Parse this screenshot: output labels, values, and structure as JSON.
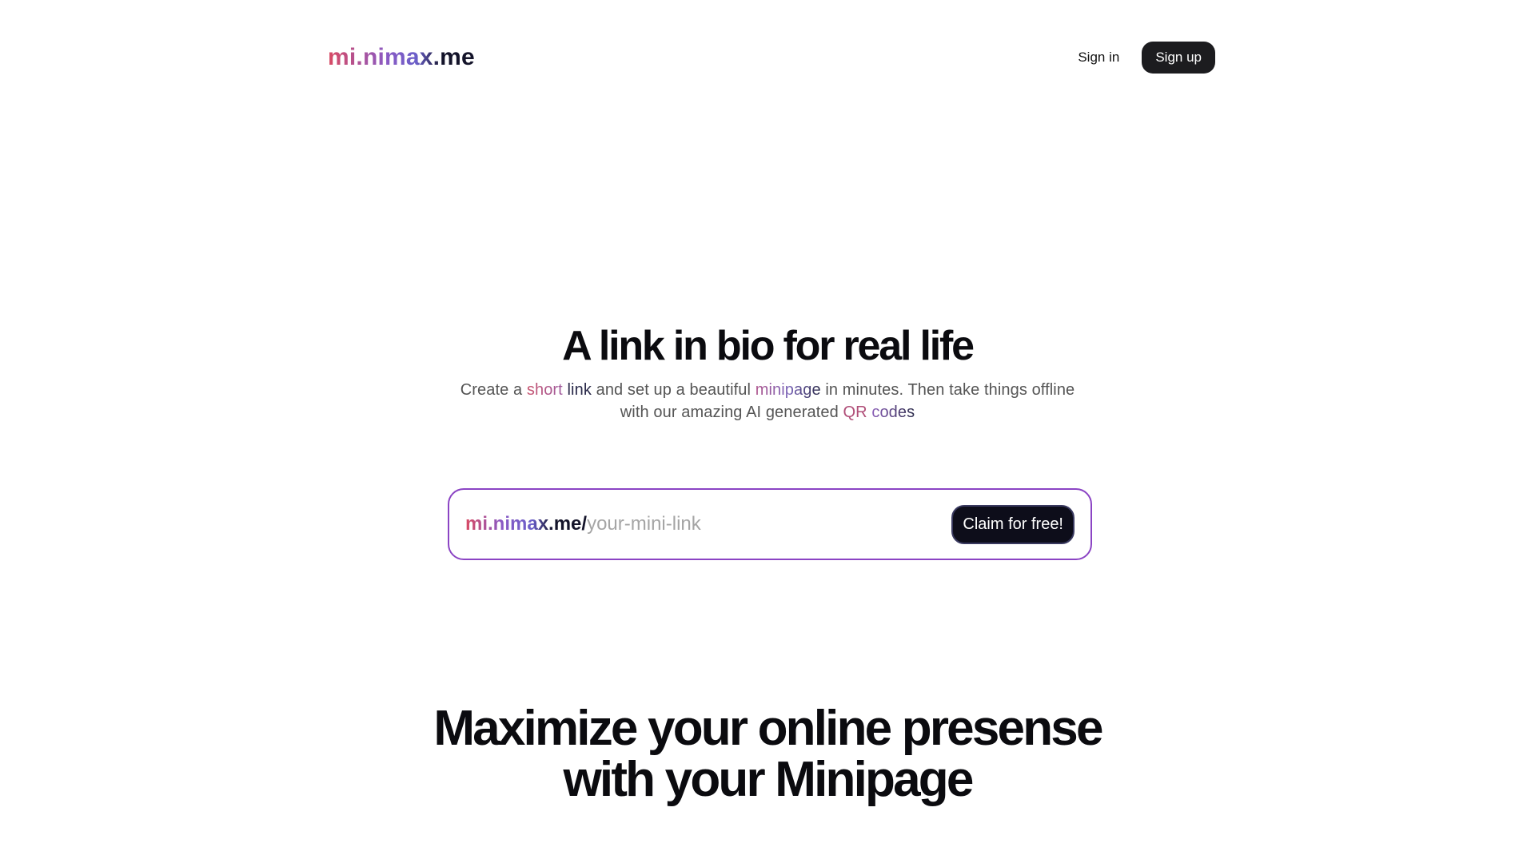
{
  "header": {
    "logo": "mi.nimax.me",
    "signin_label": "Sign in",
    "signup_label": "Sign up"
  },
  "hero": {
    "title": "A link in bio for real life",
    "subtitle": {
      "p1": "Create a ",
      "short": "short",
      "sp1": " ",
      "link": "link",
      "p2": " and set up a beautiful ",
      "minipage": "minipage",
      "p3": " in minutes. Then take things offline with our amazing AI generated ",
      "qr": "QR",
      "sp2": " ",
      "codes": "codes"
    }
  },
  "claim": {
    "prefix": "mi.nimax.me/",
    "placeholder": "your-mini-link",
    "button_label": "Claim for free!"
  },
  "section2": {
    "line1": "Maximize your online presense",
    "line2": "with your Minipage"
  },
  "colors": {
    "accent_border": "#8b44c4",
    "button_dark": "#1c1c1f",
    "gradient_start": "#d94a63",
    "gradient_mid": "#6a5fc9",
    "gradient_end": "#14142a"
  }
}
